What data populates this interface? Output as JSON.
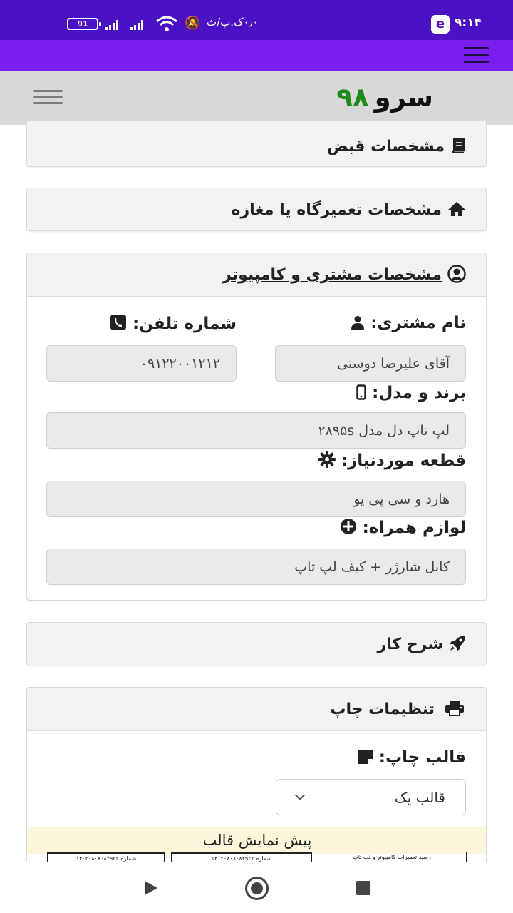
{
  "status_bar": {
    "battery": "91",
    "network_speed": "۰٫۰ک.ب/ث",
    "time": "۹:۱۴",
    "app_icon_letter": "e"
  },
  "header": {
    "logo_word": "سرو",
    "logo_number": "۹۸"
  },
  "sections": {
    "receipt": {
      "title": "مشخصات قبض",
      "icon": "book-icon"
    },
    "shop": {
      "title": "مشخصات تعمیرگاه یا مغازه",
      "icon": "home-icon"
    },
    "customer": {
      "title": "مشخصات مشتری و کامپیوتر",
      "icon": "user-circle-icon",
      "fields": {
        "name_label": "نام مشتری:",
        "name_value": "آقای علیرضا دوستی",
        "phone_label": "شماره تلفن:",
        "phone_value": "۰۹۱۲۲۰۰۱۲۱۲",
        "model_label": "برند و مدل:",
        "model_value": "لپ تاپ دل مدل ۲۸۹۵s",
        "part_label": "قطعه موردنیاز:",
        "part_value": "هارد و سی پی یو",
        "accessories_label": "لوازم همراه:",
        "accessories_value": "کابل شارژر + کیف لپ تاپ"
      }
    },
    "job": {
      "title": "شرح کار",
      "icon": "rocket-icon"
    },
    "print": {
      "title": "تنظیمات چاپ",
      "icon": "printer-icon",
      "template_label": "قالب چاپ:",
      "template_value": "قالب یک",
      "preview_title": "پیش نمایش قالب",
      "preview_thumbs": [
        "۱۴۰۲۰۸۰۸۰۸۴۹۲۲ شماره",
        "۱۴۰۲۰۸۰۸۰۸۴۹۲۲ شماره",
        "رسید تعمیرات کامپیوتر و لپ تاپ"
      ]
    }
  },
  "colors": {
    "status_bar": "#4a12c4",
    "nav_bar": "#7a1ef0",
    "header_bg": "#d8d8d8",
    "logo_number": "#1e8a1e",
    "card_head": "#f2f2f2",
    "input_bg": "#e9e9e9",
    "preview_bg": "#fbf6dc"
  }
}
